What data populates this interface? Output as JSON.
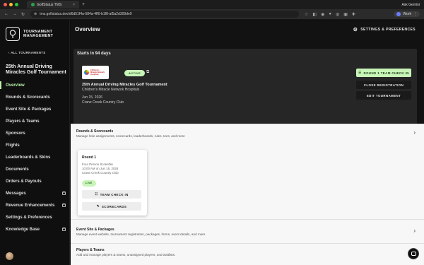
{
  "browser": {
    "tab_title": "GolfStatus TMS",
    "tab_close": "×",
    "new_tab": "+",
    "ask": "Ask Gemini",
    "url": "tms.golfstatus.dev/d6d51f4a-584a-4ff0-b1f8-af5a2d309de9",
    "profile": "Work",
    "colors": {
      "close": "#ff5f57",
      "min": "#febc2e",
      "max": "#28c840"
    }
  },
  "sidebar": {
    "brand_line1": "TOURNAMENT",
    "brand_line2": "MANAGEMENT",
    "back": "ALL TOURNAMENTS",
    "event_title": "25th Annual Driving Miracles Golf Tournament",
    "items": [
      {
        "label": "Overview",
        "active": true
      },
      {
        "label": "Rounds & Scorecards"
      },
      {
        "label": "Event Site & Packages"
      },
      {
        "label": "Players & Teams"
      },
      {
        "label": "Sponsors"
      },
      {
        "label": "Flights"
      },
      {
        "label": "Leaderboards & Skins"
      },
      {
        "label": "Documents"
      },
      {
        "label": "Orders & Payouts"
      },
      {
        "label": "Messages",
        "plus": true
      },
      {
        "label": "Revenue Enhancements",
        "plus": true
      },
      {
        "label": "Settings & Preferences"
      },
      {
        "label": "Knowledge Base",
        "plus": true
      }
    ]
  },
  "main": {
    "title": "Overview",
    "settings_label": "SETTINGS & PREFERENCES",
    "hero": {
      "starts": "Starts in 94 days",
      "status": "ACTIVE",
      "logo_text_line1": "Children's",
      "logo_text_line2": "Miracle Network",
      "logo_text_line3": "Hospitals",
      "name": "25th Annual Driving Miracles Golf Tournament",
      "org": "Children's Miracle Network Hospitals",
      "date": "Jun 15, 2026",
      "venue": "Crane Creek Country Club",
      "btn_checkin": "ROUND 1 TEAM CHECK IN",
      "btn_close": "CLOSE REGISTRATION",
      "btn_edit": "EDIT TOURNAMENT"
    },
    "rounds_section": {
      "title": "Rounds & Scorecards",
      "desc": "Manage hole assignments, scorecards, leaderboards, rules, tees, and more"
    },
    "round_card": {
      "title": "Round 1",
      "format": "Four Person Scramble",
      "time": "10:00 AM on Jun 15, 2026",
      "venue": "Crane Creek Country Club",
      "status": "LIVE",
      "btn_checkin": "TEAM CHECK IN",
      "btn_scorecards": "SCORECARDS"
    },
    "event_site_section": {
      "title": "Event Site & Packages",
      "desc": "Manage event website, tournament registration, packages, forms, event details, and more."
    },
    "players_section": {
      "title": "Players & Teams",
      "desc": "Add and manage players & teams, unassigned players, and waitlists."
    }
  }
}
